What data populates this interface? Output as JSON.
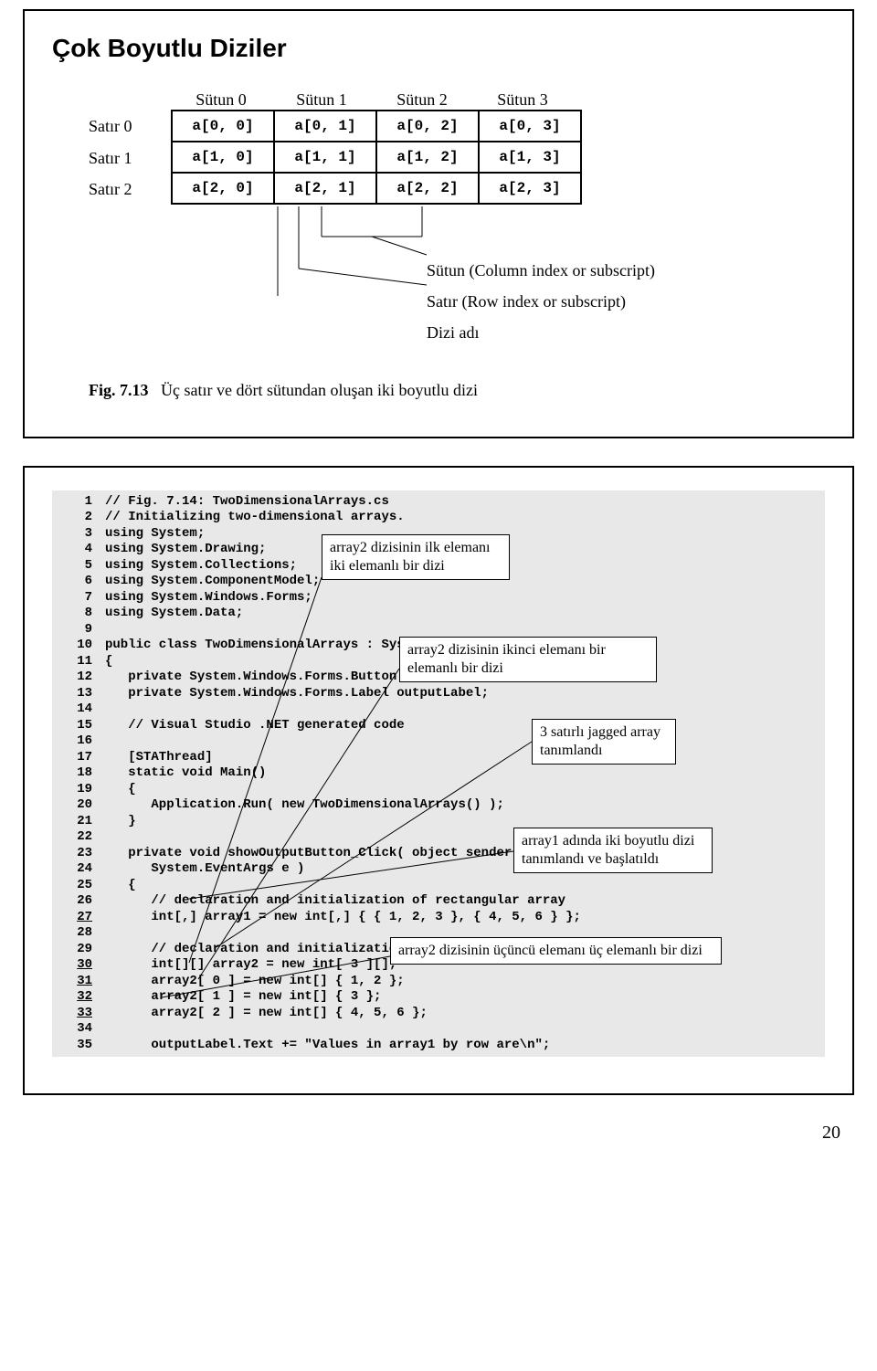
{
  "slide1": {
    "title": "Çok Boyutlu Diziler",
    "columns": [
      "Sütun 0",
      "Sütun 1",
      "Sütun 2",
      "Sütun 3"
    ],
    "rows": [
      {
        "label": "Satır 0",
        "cells": [
          "a[0, 0]",
          "a[0, 1]",
          "a[0, 2]",
          "a[0, 3]"
        ]
      },
      {
        "label": "Satır 1",
        "cells": [
          "a[1, 0]",
          "a[1, 1]",
          "a[1, 2]",
          "a[1, 3]"
        ]
      },
      {
        "label": "Satır 2",
        "cells": [
          "a[2, 0]",
          "a[2, 1]",
          "a[2, 2]",
          "a[2, 3]"
        ]
      }
    ],
    "legend": {
      "col": "Sütun (Column index or subscript)",
      "row": "Satır (Row index or subscript)",
      "name": "Dizi adı"
    },
    "caption_label": "Fig. 7.13",
    "caption_text": "Üç satır ve dört sütundan oluşan iki boyutlu dizi"
  },
  "code": {
    "lines": [
      "// Fig. 7.14: TwoDimensionalArrays.cs",
      "// Initializing two-dimensional arrays.",
      "using System;",
      "using System.Drawing;",
      "using System.Collections;",
      "using System.ComponentModel;",
      "using System.Windows.Forms;",
      "using System.Data;",
      "",
      "public class TwoDimensionalArrays : System.Windows.Forms.Form",
      "{",
      "   private System.Windows.Forms.Button showOutputButton;",
      "   private System.Windows.Forms.Label outputLabel;",
      "",
      "   // Visual Studio .NET generated code",
      "",
      "   [STAThread]",
      "   static void Main()",
      "   {",
      "      Application.Run( new TwoDimensionalArrays() );",
      "   }",
      "",
      "   private void showOutputButton_Click( object sender,",
      "      System.EventArgs e )",
      "   {",
      "      // declaration and initialization of rectangular array",
      "      int[,] array1 = new int[,] { { 1, 2, 3 }, { 4, 5, 6 } };",
      "",
      "      // declaration and initialization of jagged array",
      "      int[][] array2 = new int[ 3 ][];",
      "      array2[ 0 ] = new int[] { 1, 2 };",
      "      array2[ 1 ] = new int[] { 3 };",
      "      array2[ 2 ] = new int[] { 4, 5, 6 };",
      "",
      "      outputLabel.Text += \"Values in array1 by row are\\n\";"
    ],
    "startLineNumber": 1,
    "underlinedLineNumbers": [
      27,
      30,
      31,
      32,
      33
    ]
  },
  "callouts": {
    "c1": "array2 dizisinin ilk elemanı iki elemanlı bir dizi",
    "c2": "array2 dizisinin ikinci elemanı bir elemanlı bir dizi",
    "c3": "3 satırlı jagged array tanımlandı",
    "c4": "array1 adında iki boyutlu dizi tanımlandı ve başlatıldı",
    "c5": "array2 dizisinin üçüncü elemanı üç elemanlı bir dizi"
  },
  "pageNumber": "20"
}
